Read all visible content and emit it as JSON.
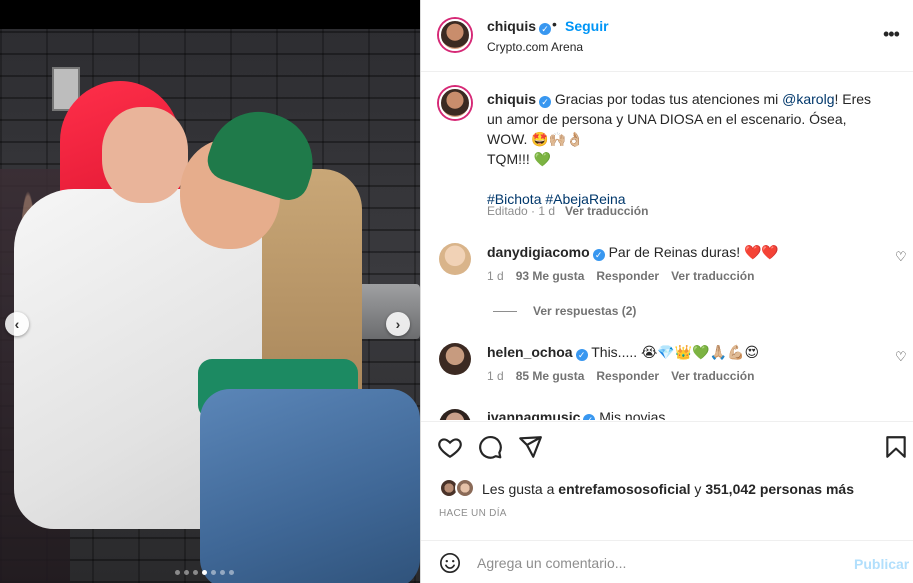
{
  "header": {
    "username": "chiquis",
    "separator": "•",
    "follow_label": "Seguir",
    "location": "Crypto.com Arena",
    "more_icon": "more-horizontal-icon"
  },
  "caption": {
    "username": "chiquis",
    "text_before": "Gracias por todas tus atenciones mi ",
    "mention": "@karolg",
    "text_after": "! Eres un amor de persona y UNA DIOSA en el escenario. Ósea, WOW. 🤩🙌🏼👌🏼",
    "line2": "TQM!!! 💚",
    "hashtag1": "#Bichota",
    "hashtag2": "#AbejaReina",
    "meta": "Editado · 1 d",
    "translate": "Ver traducción"
  },
  "comments": [
    {
      "username": "danydigiacomo",
      "text": "Par de Reinas duras! ❤️❤️",
      "time": "1 d",
      "likes": "93 Me gusta",
      "reply": "Responder",
      "translate": "Ver traducción",
      "view_replies": "Ver respuestas (2)"
    },
    {
      "username": "helen_ochoa",
      "text": "This..... 😭💎👑💚🙏🏼💪🏼😍",
      "time": "1 d",
      "likes": "85 Me gusta",
      "reply": "Responder",
      "translate": "Ver traducción"
    },
    {
      "username": "ivannagmusic",
      "text": "Mis novias"
    }
  ],
  "likes": {
    "prefix": "Les gusta a ",
    "user": "entrefamososoficial",
    "middle": " y ",
    "count": "351,042 personas más"
  },
  "timestamp": "HACE UN DÍA",
  "comment_box": {
    "placeholder": "Agrega un comentario...",
    "post_label": "Publicar"
  },
  "carousel": {
    "total": 7,
    "active_index": 3
  },
  "colors": {
    "link_blue": "#0095f6",
    "mention": "#00376b",
    "verified": "#3897f0",
    "muted": "#8e8e8e"
  }
}
